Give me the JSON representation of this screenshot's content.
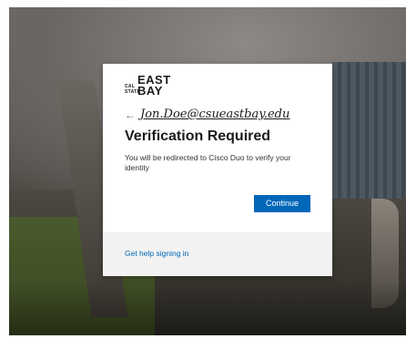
{
  "logo": {
    "small_text": "CAL STATE",
    "big_text": "EAST BAY"
  },
  "header": {
    "back_icon": "left-arrow-icon",
    "back_glyph": "←",
    "identity": "Jon.Doe@csueastbay.edu"
  },
  "main": {
    "title": "Verification Required",
    "description": "You will be redirected to Cisco Duo to verify your identity",
    "continue_label": "Continue"
  },
  "footer": {
    "help_link": "Get help signing in"
  },
  "colors": {
    "accent": "#0067b8",
    "footer_bg": "#f2f2f2"
  }
}
